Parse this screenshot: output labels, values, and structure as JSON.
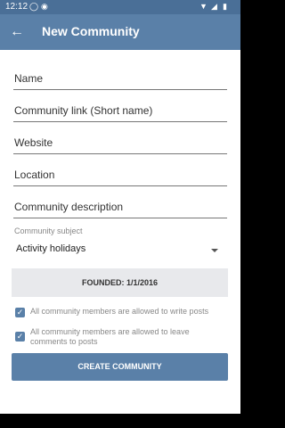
{
  "status": {
    "time": "12:12"
  },
  "appbar": {
    "title": "New Community"
  },
  "form": {
    "name_placeholder": "Name",
    "link_placeholder": "Community link (Short name)",
    "website_placeholder": "Website",
    "location_placeholder": "Location",
    "description_placeholder": "Community description",
    "subject_label": "Community subject",
    "subject_value": "Activity holidays",
    "founded_label": "FOUNDED: 1/1/2016",
    "checkbox_write": "All community members are allowed to write posts",
    "checkbox_comment": "All community members are allowed to leave comments to posts",
    "create_button": "CREATE COMMUNITY"
  },
  "colors": {
    "appbar": "#5a80a8",
    "statusbar": "#4a6f97",
    "button": "#5a80a8"
  }
}
